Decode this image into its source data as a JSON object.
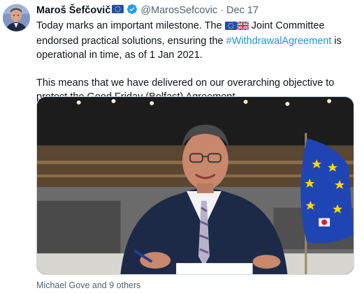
{
  "tweet": {
    "author_name": "Maroš Šefčovič",
    "author_flag_icon": "eu-flag-icon",
    "verified_icon": "verified-badge-icon",
    "handle": "@MarosSefcovic",
    "separator": "·",
    "date": "Dec 17",
    "text_part1": "Today marks an important milestone. The",
    "text_part2": "Joint Committee endorsed practical solutions, ensuring the",
    "hashtag": "#WithdrawalAgreement",
    "text_part3": "is operational in time, as of 1 Jan 2021.",
    "text_paragraph2": "This means that we have delivered on our overarching objective to protect the Good Friday (Belfast) Agreement.",
    "inline_flags": [
      "eu-flag-icon",
      "uk-flag-icon"
    ],
    "tagged_people": "Michael Gove and 9 others"
  },
  "colors": {
    "text": "#0f1419",
    "secondary": "#536471",
    "link": "#1b95e0",
    "verified": "#1d9bf0"
  }
}
